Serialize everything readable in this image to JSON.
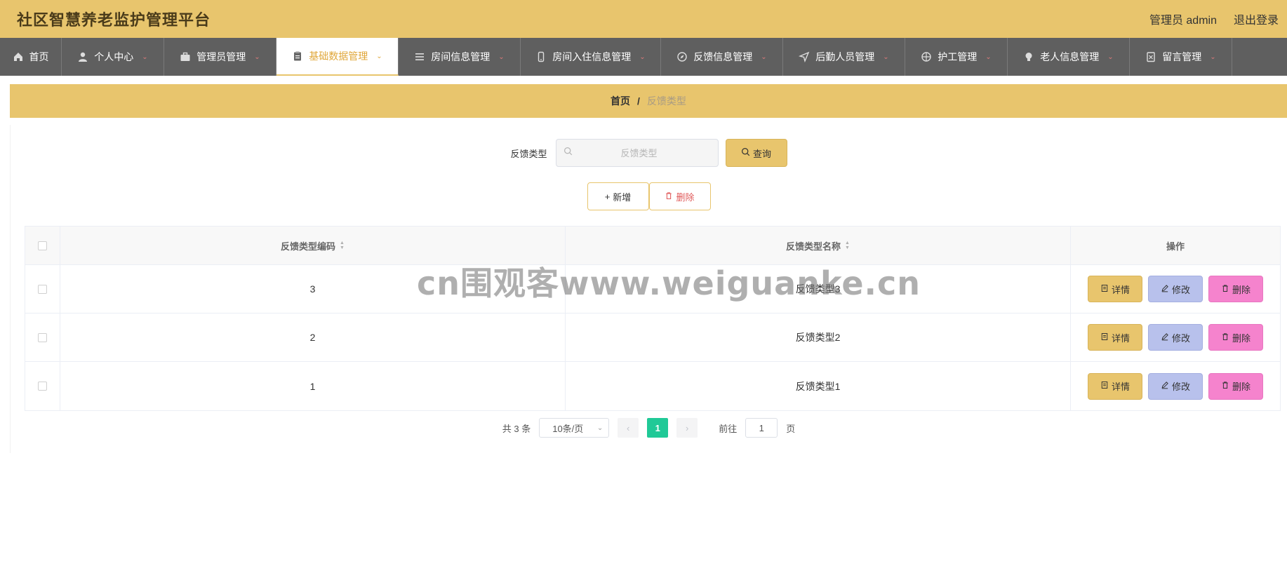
{
  "header": {
    "title": "社区智慧养老监护管理平台",
    "user": "管理员 admin",
    "logout": "退出登录"
  },
  "nav": [
    {
      "label": "首页",
      "icon": "home-icon"
    },
    {
      "label": "个人中心",
      "icon": "user-icon"
    },
    {
      "label": "管理员管理",
      "icon": "briefcase-icon"
    },
    {
      "label": "基础数据管理",
      "icon": "clipboard-icon",
      "active": true
    },
    {
      "label": "房间信息管理",
      "icon": "list-icon"
    },
    {
      "label": "房间入住信息管理",
      "icon": "phone-icon"
    },
    {
      "label": "反馈信息管理",
      "icon": "compass-icon"
    },
    {
      "label": "后勤人员管理",
      "icon": "navigation-icon"
    },
    {
      "label": "护工管理",
      "icon": "target-icon"
    },
    {
      "label": "老人信息管理",
      "icon": "bulb-icon"
    },
    {
      "label": "留言管理",
      "icon": "document-icon"
    }
  ],
  "breadcrumb": {
    "home": "首页",
    "sep": "/",
    "current": "反馈类型"
  },
  "search": {
    "label": "反馈类型",
    "placeholder": "反馈类型",
    "button": "查询"
  },
  "actions": {
    "add": "新增",
    "delete": "删除"
  },
  "table": {
    "headers": {
      "code": "反馈类型编码",
      "name": "反馈类型名称",
      "ops": "操作"
    },
    "rows": [
      {
        "code": "3",
        "name": "反馈类型3"
      },
      {
        "code": "2",
        "name": "反馈类型2"
      },
      {
        "code": "1",
        "name": "反馈类型1"
      }
    ],
    "row_actions": {
      "detail": "详情",
      "edit": "修改",
      "remove": "删除"
    }
  },
  "pagination": {
    "total": "共 3 条",
    "page_size": "10条/页",
    "current": "1",
    "goto_label": "前往",
    "goto_value": "1",
    "page_suffix": "页"
  },
  "watermark": "cn围观客www.weiguanke.cn",
  "colors": {
    "accent": "#e8c56d",
    "nav_bg": "#5f5f5f",
    "edit": "#b8c1ec",
    "remove": "#f583cd",
    "page_active": "#20c997"
  }
}
